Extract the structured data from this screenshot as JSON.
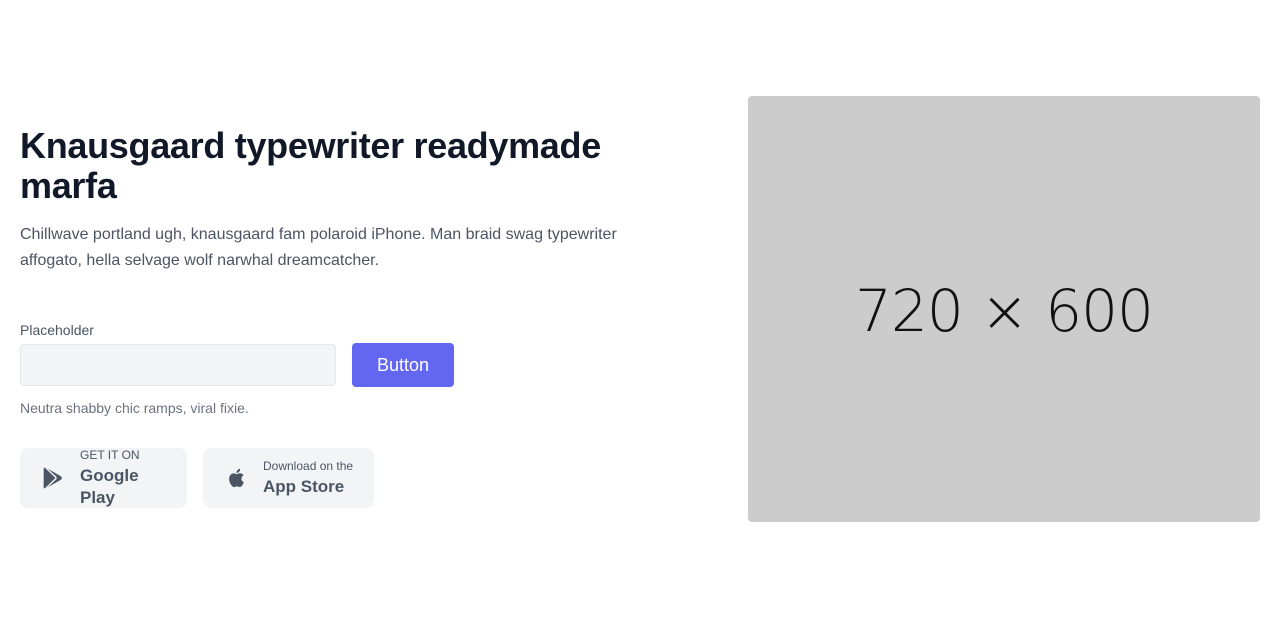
{
  "hero": {
    "headline": "Knausgaard typewriter readymade marfa",
    "description": "Chillwave portland ugh, knausgaard fam polaroid iPhone. Man braid swag typewriter affogato, hella selvage wolf narwhal dreamcatcher."
  },
  "signup": {
    "label": "Placeholder",
    "input_value": "",
    "button_label": "Button",
    "helper_text": "Neutra shabby chic ramps, viral fixie."
  },
  "stores": {
    "google_play": {
      "small": "GET IT ON",
      "big": "Google Play",
      "icon": "google-play-icon"
    },
    "app_store": {
      "small": "Download on the",
      "big": "App Store",
      "icon": "apple-icon"
    }
  },
  "image": {
    "label": "720 × 600"
  },
  "colors": {
    "accent": "#6366f1",
    "placeholder_bg": "#cccccc",
    "store_bg": "#f3f4f6"
  }
}
